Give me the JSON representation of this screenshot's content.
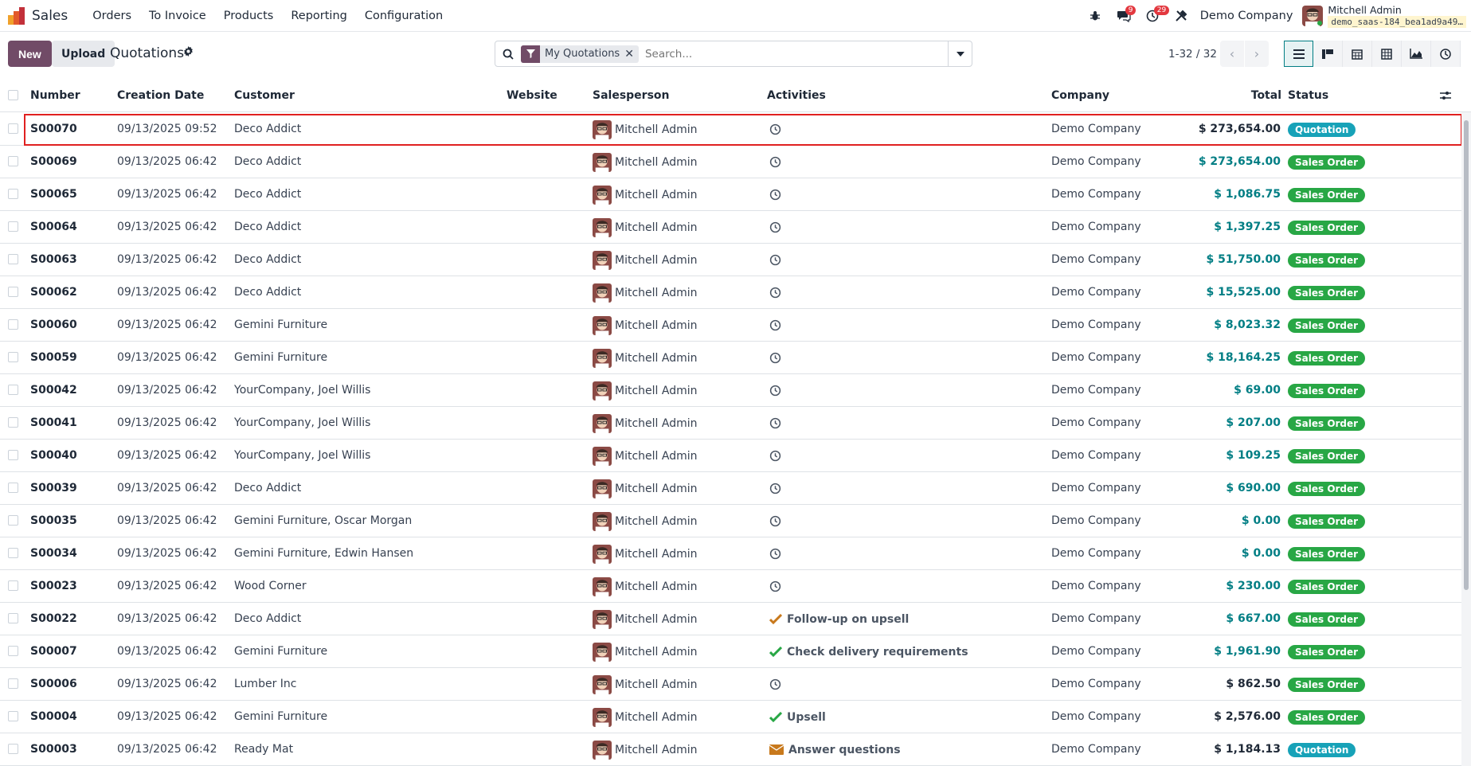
{
  "app": {
    "name": "Sales"
  },
  "menu": [
    "Orders",
    "To Invoice",
    "Products",
    "Reporting",
    "Configuration"
  ],
  "systray": {
    "messages_count": "9",
    "activities_count": "29",
    "company": "Demo Company",
    "user": "Mitchell Admin",
    "db": "demo_saas-184_bea1ad9a49…"
  },
  "control": {
    "new_label": "New",
    "upload_label": "Upload",
    "title": "Quotations",
    "facet": "My Quotations",
    "search_placeholder": "Search...",
    "pager": "1-32 / 32"
  },
  "columns": {
    "number": "Number",
    "creation_date": "Creation Date",
    "customer": "Customer",
    "website": "Website",
    "salesperson": "Salesperson",
    "activities": "Activities",
    "company": "Company",
    "total": "Total",
    "status": "Status"
  },
  "colors": {
    "brand": "#714b67",
    "link_total": "#017e84",
    "quotation": "#17a2b8",
    "sales_order": "#28a745"
  },
  "rows": [
    {
      "number": "S00070",
      "date": "09/13/2025 09:52",
      "customer": "Deco Addict",
      "salesperson": "Mitchell Admin",
      "activity": "",
      "activity_icon": "clock-icon",
      "company": "Demo Company",
      "total": "$ 273,654.00",
      "total_style": "dark",
      "status": "Quotation"
    },
    {
      "number": "S00069",
      "date": "09/13/2025 06:42",
      "customer": "Deco Addict",
      "salesperson": "Mitchell Admin",
      "activity": "",
      "activity_icon": "clock-icon",
      "company": "Demo Company",
      "total": "$ 273,654.00",
      "total_style": "link",
      "status": "Sales Order"
    },
    {
      "number": "S00065",
      "date": "09/13/2025 06:42",
      "customer": "Deco Addict",
      "salesperson": "Mitchell Admin",
      "activity": "",
      "activity_icon": "clock-icon",
      "company": "Demo Company",
      "total": "$ 1,086.75",
      "total_style": "link",
      "status": "Sales Order"
    },
    {
      "number": "S00064",
      "date": "09/13/2025 06:42",
      "customer": "Deco Addict",
      "salesperson": "Mitchell Admin",
      "activity": "",
      "activity_icon": "clock-icon",
      "company": "Demo Company",
      "total": "$ 1,397.25",
      "total_style": "link",
      "status": "Sales Order"
    },
    {
      "number": "S00063",
      "date": "09/13/2025 06:42",
      "customer": "Deco Addict",
      "salesperson": "Mitchell Admin",
      "activity": "",
      "activity_icon": "clock-icon",
      "company": "Demo Company",
      "total": "$ 51,750.00",
      "total_style": "link",
      "status": "Sales Order"
    },
    {
      "number": "S00062",
      "date": "09/13/2025 06:42",
      "customer": "Deco Addict",
      "salesperson": "Mitchell Admin",
      "activity": "",
      "activity_icon": "clock-icon",
      "company": "Demo Company",
      "total": "$ 15,525.00",
      "total_style": "link",
      "status": "Sales Order"
    },
    {
      "number": "S00060",
      "date": "09/13/2025 06:42",
      "customer": "Gemini Furniture",
      "salesperson": "Mitchell Admin",
      "activity": "",
      "activity_icon": "clock-icon",
      "company": "Demo Company",
      "total": "$ 8,023.32",
      "total_style": "link",
      "status": "Sales Order"
    },
    {
      "number": "S00059",
      "date": "09/13/2025 06:42",
      "customer": "Gemini Furniture",
      "salesperson": "Mitchell Admin",
      "activity": "",
      "activity_icon": "clock-icon",
      "company": "Demo Company",
      "total": "$ 18,164.25",
      "total_style": "link",
      "status": "Sales Order"
    },
    {
      "number": "S00042",
      "date": "09/13/2025 06:42",
      "customer": "YourCompany, Joel Willis",
      "salesperson": "Mitchell Admin",
      "activity": "",
      "activity_icon": "clock-icon",
      "company": "Demo Company",
      "total": "$ 69.00",
      "total_style": "link",
      "status": "Sales Order"
    },
    {
      "number": "S00041",
      "date": "09/13/2025 06:42",
      "customer": "YourCompany, Joel Willis",
      "salesperson": "Mitchell Admin",
      "activity": "",
      "activity_icon": "clock-icon",
      "company": "Demo Company",
      "total": "$ 207.00",
      "total_style": "link",
      "status": "Sales Order"
    },
    {
      "number": "S00040",
      "date": "09/13/2025 06:42",
      "customer": "YourCompany, Joel Willis",
      "salesperson": "Mitchell Admin",
      "activity": "",
      "activity_icon": "clock-icon",
      "company": "Demo Company",
      "total": "$ 109.25",
      "total_style": "link",
      "status": "Sales Order"
    },
    {
      "number": "S00039",
      "date": "09/13/2025 06:42",
      "customer": "Deco Addict",
      "salesperson": "Mitchell Admin",
      "activity": "",
      "activity_icon": "clock-icon",
      "company": "Demo Company",
      "total": "$ 690.00",
      "total_style": "link",
      "status": "Sales Order"
    },
    {
      "number": "S00035",
      "date": "09/13/2025 06:42",
      "customer": "Gemini Furniture, Oscar Morgan",
      "salesperson": "Mitchell Admin",
      "activity": "",
      "activity_icon": "clock-icon",
      "company": "Demo Company",
      "total": "$ 0.00",
      "total_style": "link",
      "status": "Sales Order"
    },
    {
      "number": "S00034",
      "date": "09/13/2025 06:42",
      "customer": "Gemini Furniture, Edwin Hansen",
      "salesperson": "Mitchell Admin",
      "activity": "",
      "activity_icon": "clock-icon",
      "company": "Demo Company",
      "total": "$ 0.00",
      "total_style": "link",
      "status": "Sales Order"
    },
    {
      "number": "S00023",
      "date": "09/13/2025 06:42",
      "customer": "Wood Corner",
      "salesperson": "Mitchell Admin",
      "activity": "",
      "activity_icon": "clock-icon",
      "company": "Demo Company",
      "total": "$ 230.00",
      "total_style": "link",
      "status": "Sales Order"
    },
    {
      "number": "S00022",
      "date": "09/13/2025 06:42",
      "customer": "Deco Addict",
      "salesperson": "Mitchell Admin",
      "activity": "Follow-up on upsell",
      "activity_icon": "check-orange-icon",
      "company": "Demo Company",
      "total": "$ 667.00",
      "total_style": "link",
      "status": "Sales Order"
    },
    {
      "number": "S00007",
      "date": "09/13/2025 06:42",
      "customer": "Gemini Furniture",
      "salesperson": "Mitchell Admin",
      "activity": "Check delivery requirements",
      "activity_icon": "check-green-icon",
      "company": "Demo Company",
      "total": "$ 1,961.90",
      "total_style": "link",
      "status": "Sales Order"
    },
    {
      "number": "S00006",
      "date": "09/13/2025 06:42",
      "customer": "Lumber Inc",
      "salesperson": "Mitchell Admin",
      "activity": "",
      "activity_icon": "clock-icon",
      "company": "Demo Company",
      "total": "$ 862.50",
      "total_style": "dark",
      "status": "Sales Order"
    },
    {
      "number": "S00004",
      "date": "09/13/2025 06:42",
      "customer": "Gemini Furniture",
      "salesperson": "Mitchell Admin",
      "activity": "Upsell",
      "activity_icon": "check-green-icon",
      "company": "Demo Company",
      "total": "$ 2,576.00",
      "total_style": "dark",
      "status": "Sales Order"
    },
    {
      "number": "S00003",
      "date": "09/13/2025 06:42",
      "customer": "Ready Mat",
      "salesperson": "Mitchell Admin",
      "activity": "Answer questions",
      "activity_icon": "envelope-icon",
      "company": "Demo Company",
      "total": "$ 1,184.13",
      "total_style": "dark",
      "status": "Quotation"
    }
  ]
}
